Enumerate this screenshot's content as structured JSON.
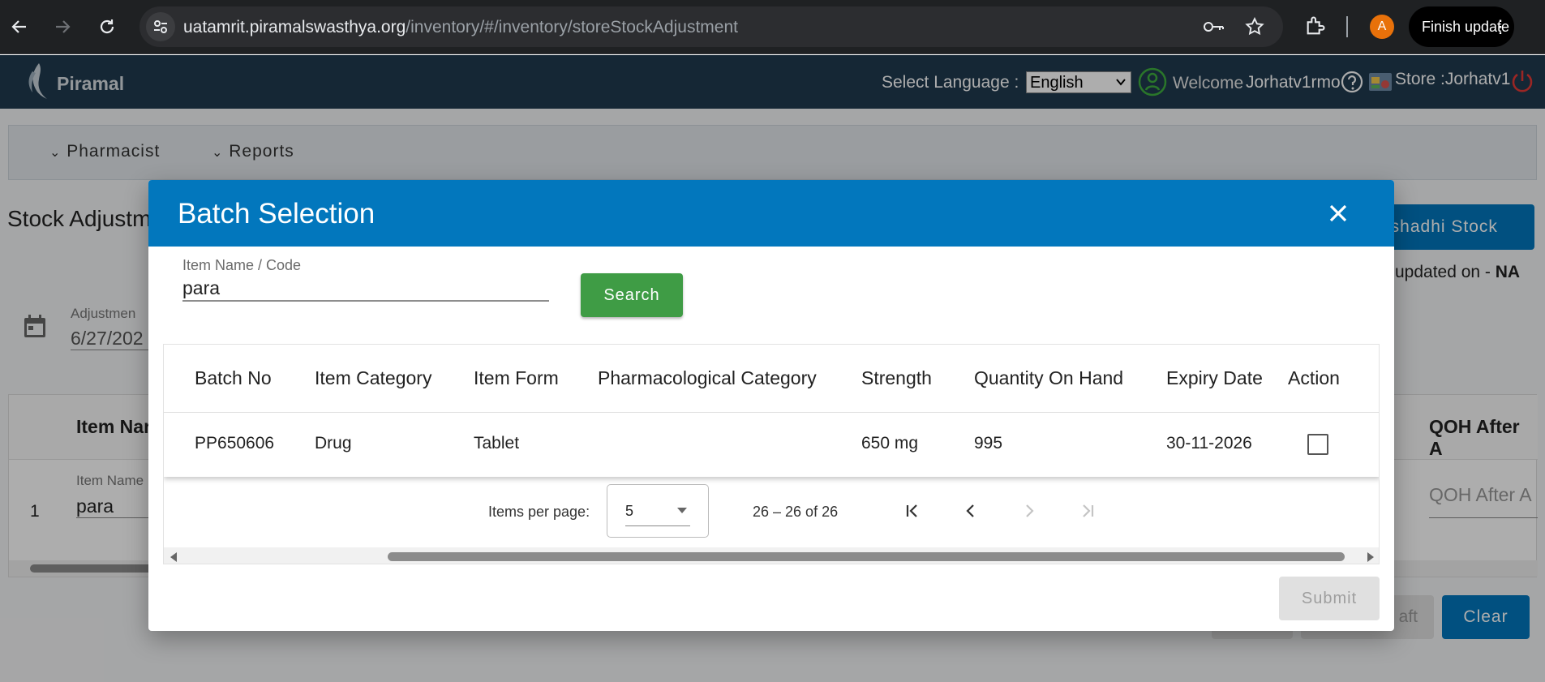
{
  "browser": {
    "url_host": "uatamrit.piramalswasthya.org",
    "url_path": "/inventory/#/inventory/storeStockAdjustment",
    "profile_initial": "A",
    "finish_update_label": "Finish update",
    "profile_color": "#e8710a"
  },
  "header": {
    "brand": "Piramal",
    "language_label": "Select Language :",
    "language_value": "English",
    "welcome_label": "Welcome",
    "user_name": "Jorhatv1rmo",
    "store_label": "Store :Jorhatv1"
  },
  "menu": {
    "items": [
      {
        "label": "Pharmacist"
      },
      {
        "label": "Reports"
      }
    ]
  },
  "page": {
    "title_partial": "Stock Adjustm",
    "right_button_partial": "ushadhi Stock",
    "updated_partial": "updated on - ",
    "updated_value": "NA",
    "date_label_partial": "Adjustmen",
    "date_value_partial": "6/27/202",
    "table": {
      "item_name_header": "Item Nar",
      "qoh_after_header": "QOH After A",
      "row_index": "1",
      "item_name_label": "Item Name",
      "item_name_value": "para",
      "qoh_placeholder": "QOH After A"
    },
    "draft_partial": "aft",
    "clear_label": "Clear"
  },
  "modal": {
    "title": "Batch Selection",
    "search_field_label": "Item Name / Code",
    "search_value": "para",
    "search_button": "Search",
    "columns": [
      "Batch No",
      "Item Category",
      "Item Form",
      "Pharmacological Category",
      "Strength",
      "Quantity On Hand",
      "Expiry Date",
      "Action"
    ],
    "rows": [
      {
        "batch_no": "PP650606",
        "item_category": "Drug",
        "item_form": "Tablet",
        "pharmacological_category": "",
        "strength": "650 mg",
        "quantity_on_hand": "995",
        "expiry_date": "30-11-2026",
        "action_checked": false
      }
    ],
    "pagination": {
      "items_per_page_label": "Items per page:",
      "items_per_page_value": "5",
      "range_label": "26 – 26 of 26"
    },
    "submit_button": "Submit",
    "accent": "#0277bd",
    "search_color": "#3f9c45"
  }
}
